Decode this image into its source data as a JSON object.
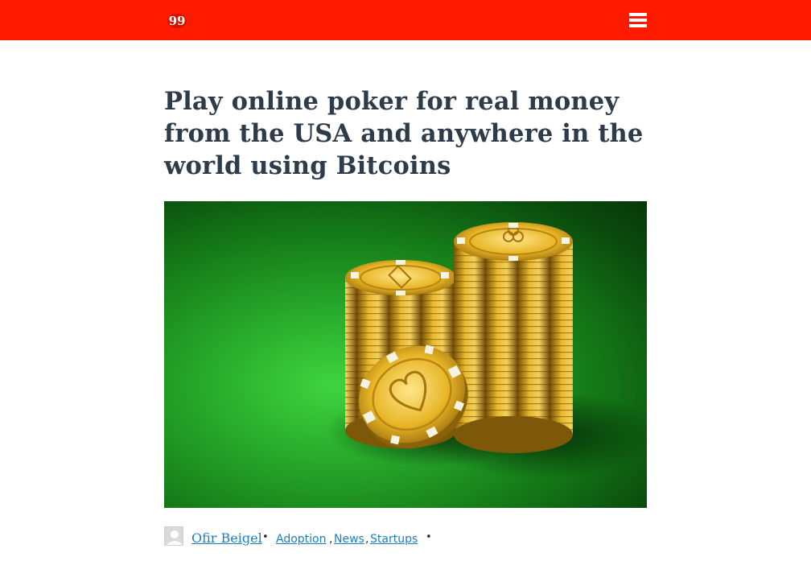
{
  "header": {
    "logo_text": "99",
    "menu_icon": "hamburger-menu-icon",
    "background_color": "#ff1a00"
  },
  "article": {
    "title": "Play online poker for real money from the USA and anywhere in the world using Bitcoins",
    "hero_image": "poker-chips-on-green-felt",
    "meta": {
      "author": "Ofir Beigel",
      "separator": "•",
      "categories": [
        "Adoption",
        "News",
        "Startups"
      ],
      "category_separator": ","
    }
  },
  "colors": {
    "title": "#2e3c4a",
    "link": "#1a7fc1",
    "felt": "#1f8f22",
    "chip_gold": "#e6b21f"
  }
}
